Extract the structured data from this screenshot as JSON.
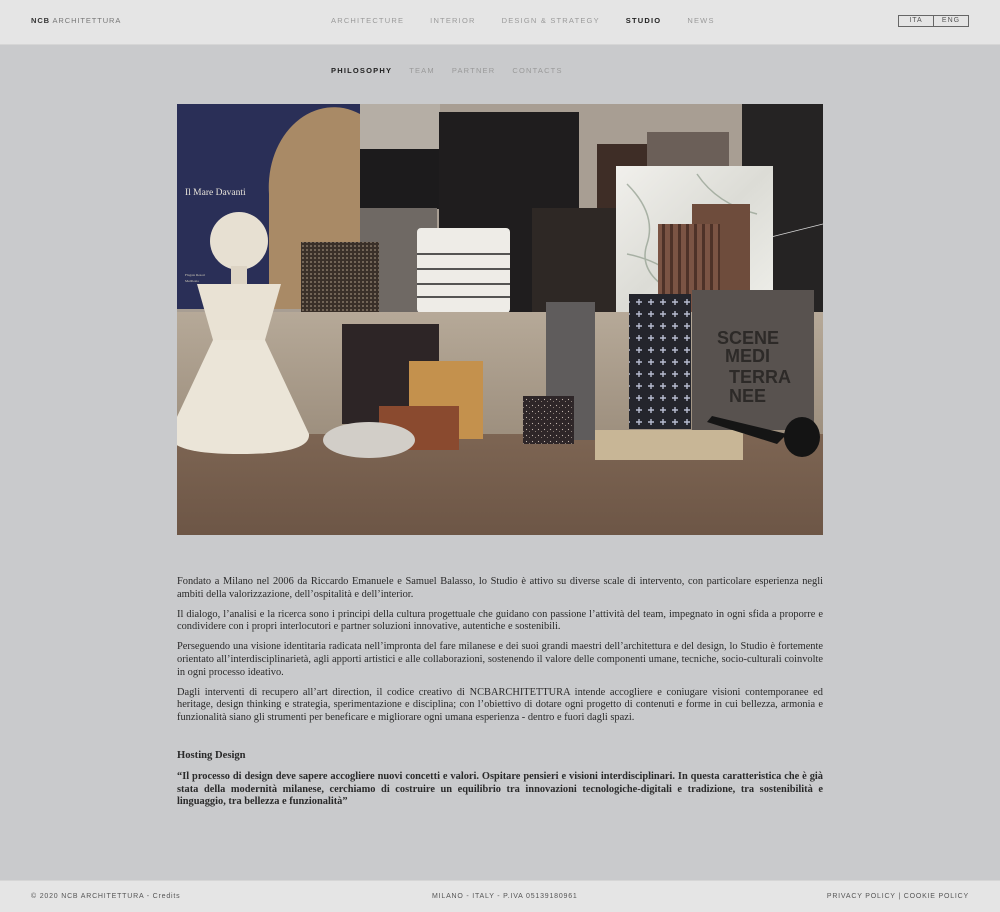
{
  "header": {
    "brand_bold": "NCB",
    "brand_rest": "ARCHITETTURA",
    "nav": [
      {
        "label": "ARCHITECTURE",
        "active": false
      },
      {
        "label": "INTERIOR",
        "active": false
      },
      {
        "label": "DESIGN & STRATEGY",
        "active": false
      },
      {
        "label": "STUDIO",
        "active": true
      },
      {
        "label": "NEWS",
        "active": false
      }
    ],
    "languages": [
      "ITA",
      "ENG"
    ]
  },
  "subnav": [
    {
      "label": "PHILOSOPHY",
      "active": true
    },
    {
      "label": "TEAM",
      "active": false
    },
    {
      "label": "PARTNER",
      "active": false
    },
    {
      "label": "CONTACTS",
      "active": false
    }
  ],
  "hero": {
    "description": "Moodboard of material samples: ceramic vase, marble, wood, textiles, door handle",
    "book_title": "Il Mare Davanti",
    "panel_text": [
      "SCENE",
      "MEDI",
      "TERRA",
      "NEE"
    ]
  },
  "content": {
    "paragraphs": [
      "Fondato a Milano nel 2006 da Riccardo Emanuele e Samuel Balasso, lo Studio è attivo su diverse scale di intervento, con particolare esperienza negli ambiti della valorizzazione, dell’ospitalità e dell’interior.",
      "Il dialogo, l’analisi e la ricerca sono i principi della cultura progettuale che guidano con passione l’attività del team, impegnato in ogni sfida a proporre e condividere con i propri interlocutori e partner soluzioni innovative, autentiche e sostenibili.",
      "Perseguendo una visione identitaria radicata nell’impronta del fare milanese e dei suoi grandi maestri dell’architettura e del design, lo Studio è fortemente orientato all’interdisciplinarietà, agli apporti artistici e alle collaborazioni, sostenendo il valore delle componenti umane, tecniche, socio-culturali coinvolte in ogni processo ideativo.",
      "Dagli interventi di recupero all’art direction, il codice creativo di NCBARCHITETTURA intende accogliere e coniugare visioni contemporanee ed heritage, design thinking e strategia, sperimentazione e disciplina; con l’obiettivo di dotare ogni progetto di contenuti e forme in cui bellezza, armonia e funzionalità siano gli strumenti per beneficare e migliorare ogni umana esperienza - dentro e fuori dagli spazi."
    ],
    "section_title": "Hosting Design",
    "quote": "“Il processo di design deve sapere accogliere nuovi concetti e valori. Ospitare pensieri e visioni interdisciplinari. In questa caratteristica che è già stata della modernità milanese, cerchiamo di costruire un equilibrio tra innovazioni tecnologiche-digitali e tradizione, tra sostenibilità e linguaggio, tra bellezza e funzionalità”"
  },
  "footer": {
    "copyright": "© 2020 NCB ARCHITETTURA - ",
    "credits": "Credits",
    "address": "MILANO - ITALY - P.IVA 05139180961",
    "privacy": "PRIVACY POLICY",
    "separator": " | ",
    "cookie": "COOKIE POLICY"
  }
}
